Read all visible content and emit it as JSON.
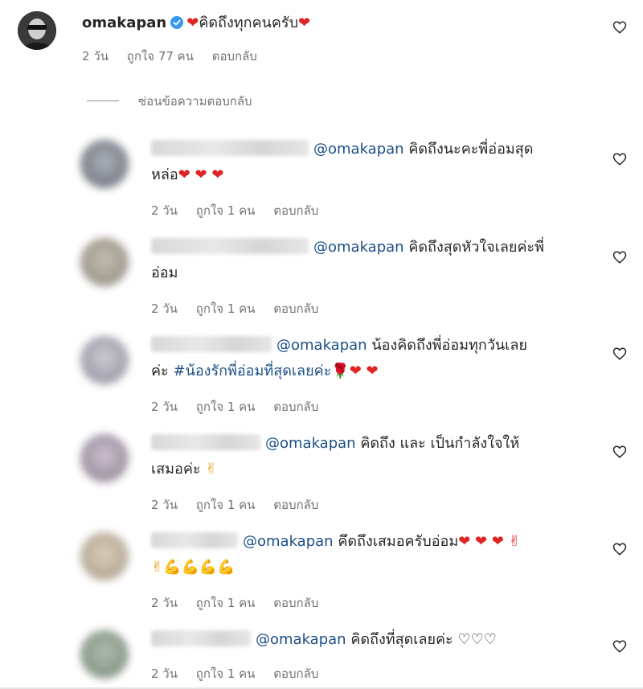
{
  "main": {
    "username": "omakapan",
    "text": "คิดถึงทุกคนครับ",
    "heart": "❤",
    "time": "2 วัน",
    "likes": "ถูกใจ 77 คน",
    "reply": "ตอบกลับ"
  },
  "hide_replies": "ซ่อนข้อความตอบกลับ",
  "replies": [
    {
      "mention": "@omakapan",
      "text1": "คิดถึงนะคะพี่อ่อมสุด",
      "text2": "หล่อ",
      "emojis": "❤ ❤ ❤",
      "time": "2 วัน",
      "likes": "ถูกใจ 1 คน",
      "reply": "ตอบกลับ",
      "avatar_color": "#6a6f7a"
    },
    {
      "mention": "@omakapan",
      "text1": "คิดถึงสุดหัวใจเลยค่ะพี่",
      "text2": "อ่อม",
      "emojis": "",
      "time": "2 วัน",
      "likes": "ถูกใจ 1 คน",
      "reply": "ตอบกลับ",
      "avatar_color": "#8f8a7c"
    },
    {
      "mention": "@omakapan",
      "text1": "น้องคิดถึงพี่อ่อมทุกวันเลย",
      "text2": "ค่ะ",
      "hashtag": "#น้องรักพี่อ่อมที่สุดเลยค่ะ",
      "emojis": "🌹❤ ❤",
      "time": "2 วัน",
      "likes": "ถูกใจ 1 คน",
      "reply": "ตอบกลับ",
      "avatar_color": "#9a97a6"
    },
    {
      "mention": "@omakapan",
      "text1": "คิดถึง และ เป็นกำลังใจให้",
      "text2": "เสมอค่ะ",
      "emojis": "✌",
      "time": "2 วัน",
      "likes": "ถูกใจ 1 คน",
      "reply": "ตอบกลับ",
      "avatar_color": "#8e7f93"
    },
    {
      "mention": "@omakapan",
      "text1": "คึดถึงเสมอครับอ่อม",
      "emojis1": "❤ ❤ ❤ ✌",
      "text2": "",
      "emojis": "✌💪💪💪💪",
      "time": "2 วัน",
      "likes": "ถูกใจ 1 คน",
      "reply": "ตอบกลับ",
      "avatar_color": "#a99a82"
    },
    {
      "mention": "@omakapan",
      "text1": "คิดถึงที่สุดเลยค่ะ",
      "emojis1": "♡♡♡",
      "text2": "",
      "emojis": "",
      "time": "2 วัน",
      "likes": "ถูกใจ 1 คน",
      "reply": "ตอบกลับ",
      "avatar_color": "#6f8270"
    }
  ],
  "colors": {
    "heart": "#e02424",
    "mention": "#1c4f86",
    "meta": "#737373",
    "verified": "#3897f0"
  },
  "icons": {
    "like": "heart-outline-icon",
    "verified": "verified-badge-icon"
  }
}
